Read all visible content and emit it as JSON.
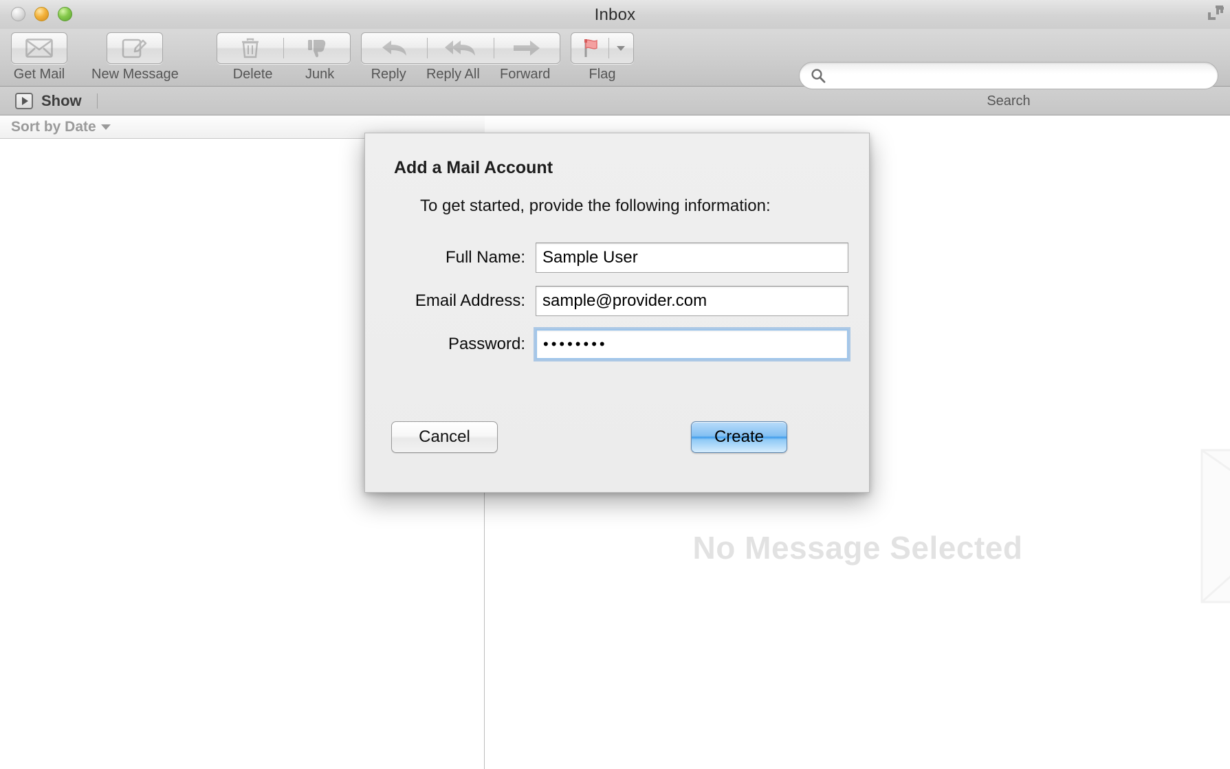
{
  "window": {
    "title": "Inbox",
    "traffic_lights": [
      "close",
      "minimize",
      "zoom"
    ],
    "resize_icon": "resize-corner-icon"
  },
  "toolbar": {
    "items": [
      {
        "label": "Get Mail",
        "icon": "envelope-icon"
      },
      {
        "label": "New Message",
        "icon": "compose-pencil-icon"
      },
      {
        "label": "Delete",
        "icon": "trash-icon"
      },
      {
        "label": "Junk",
        "icon": "thumbs-down-icon"
      },
      {
        "label": "Reply",
        "icon": "reply-arrow-icon"
      },
      {
        "label": "Reply All",
        "icon": "reply-all-arrow-icon"
      },
      {
        "label": "Forward",
        "icon": "forward-arrow-icon"
      },
      {
        "label": "Flag",
        "icon": "red-flag-icon"
      }
    ],
    "flag_menu_icon": "chevron-down-icon"
  },
  "search": {
    "label": "Search",
    "placeholder": "",
    "value": "",
    "icon": "search-icon"
  },
  "showbar": {
    "label": "Show",
    "icon": "disclosure-play-icon"
  },
  "message_list": {
    "sort_label": "Sort by Date",
    "sort_caret_icon": "caret-down-icon",
    "rows": []
  },
  "message_pane": {
    "empty_text": "No Message Selected",
    "watermark_icon": "envelope-watermark-icon"
  },
  "dialog": {
    "title": "Add a Mail Account",
    "subtitle": "To get started, provide the following information:",
    "fields": [
      {
        "label": "Full Name:",
        "value": "Sample User",
        "placeholder": "",
        "type": "text",
        "focused": false
      },
      {
        "label": "Email Address:",
        "value": "sample@provider.com",
        "placeholder": "",
        "type": "text",
        "focused": false
      },
      {
        "label": "Password:",
        "value": "••••••••",
        "placeholder": "",
        "type": "password",
        "focused": true
      }
    ],
    "cancel_label": "Cancel",
    "create_label": "Create"
  },
  "colors": {
    "accent_blue": "#3f9ceb",
    "focus_ring": "#76aade",
    "toolbar_gray": "#cfcfcf",
    "dialog_bg": "#ececec",
    "empty_text": "#e2e2e2"
  }
}
